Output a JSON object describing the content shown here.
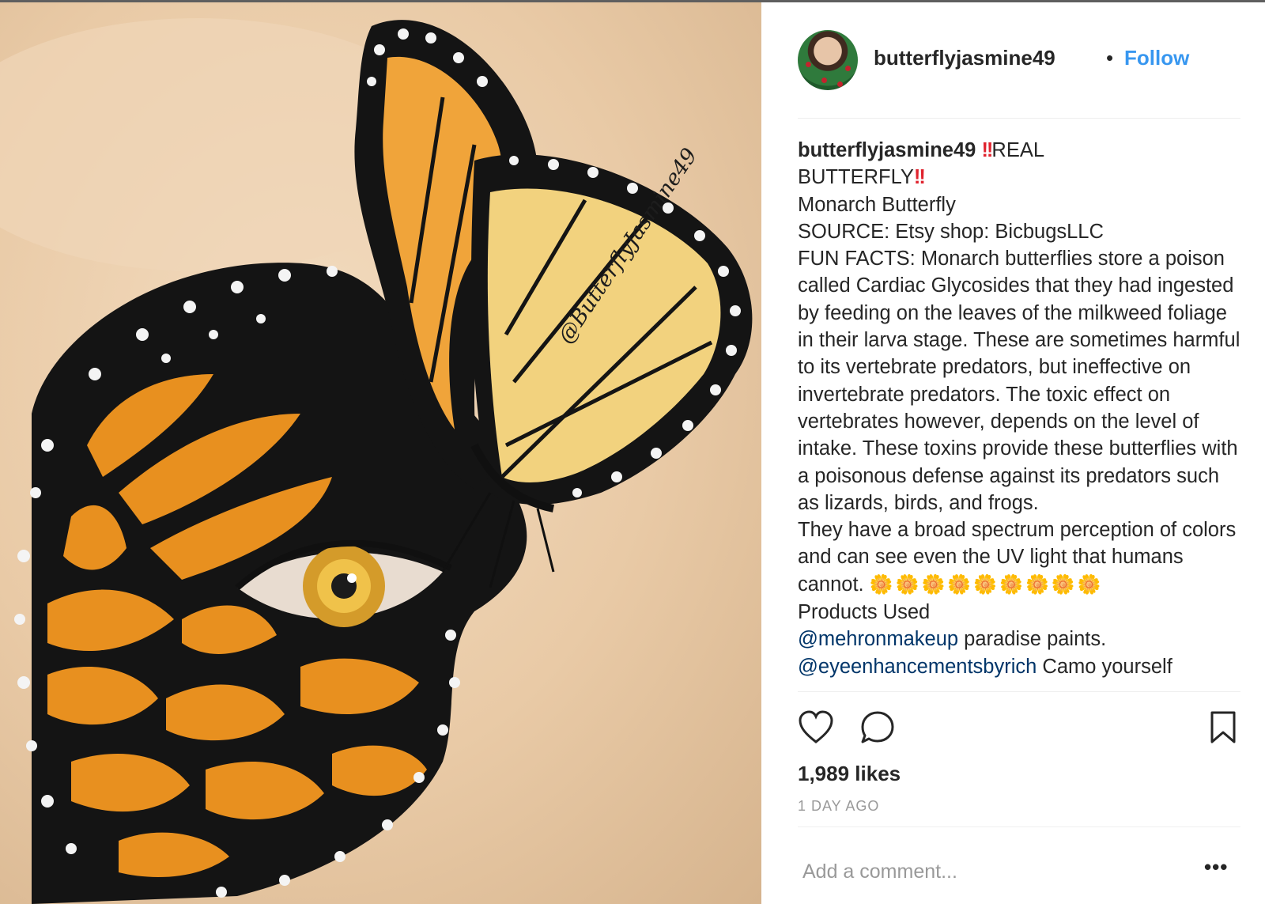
{
  "post": {
    "watermark": "@ButterflyJasmine49"
  },
  "header": {
    "username": "butterflyjasmine49",
    "separator": "•",
    "follow_label": "Follow"
  },
  "caption": {
    "username": "butterflyjasmine49",
    "line1_suffix": "REAL",
    "line2": "BUTTERFLY",
    "line3": "Monarch Butterfly",
    "line4": "SOURCE: Etsy shop: BicbugsLLC",
    "fun_facts": "FUN FACTS: Monarch butterflies store a poison called Cardiac Glycosides that they had ingested by feeding on the leaves of the milkweed foliage in their larva stage. These are sometimes harmful to its vertebrate predators, but ineffective on invertebrate predators. The toxic effect on vertebrates however, depends on the level of intake. These toxins provide these butterflies with a poisonous defense against its predators such as lizards, birds, and frogs.",
    "uv_text": "They have a broad spectrum  perception of colors and can see even the UV light that humans cannot.",
    "flowers": "🌼🌼🌼🌼🌼🌼🌼🌼🌼",
    "products_label": "Products Used",
    "mention1": "@mehronmakeup",
    "mention1_suffix": " paradise paints.",
    "mention2": "@eyeenhancementsbyrich",
    "mention2_suffix": " Camo yourself"
  },
  "actions": {
    "like_icon": "heart-icon",
    "comment_icon": "comment-bubble-icon",
    "save_icon": "bookmark-icon"
  },
  "likes": "1,989 likes",
  "timestamp": "1 DAY AGO",
  "comment": {
    "placeholder": "Add a comment...",
    "more_label": "•••"
  },
  "colors": {
    "follow": "#3897f0",
    "mention": "#003569",
    "muted": "#999999",
    "text": "#262626",
    "warning": "#e0232e"
  }
}
